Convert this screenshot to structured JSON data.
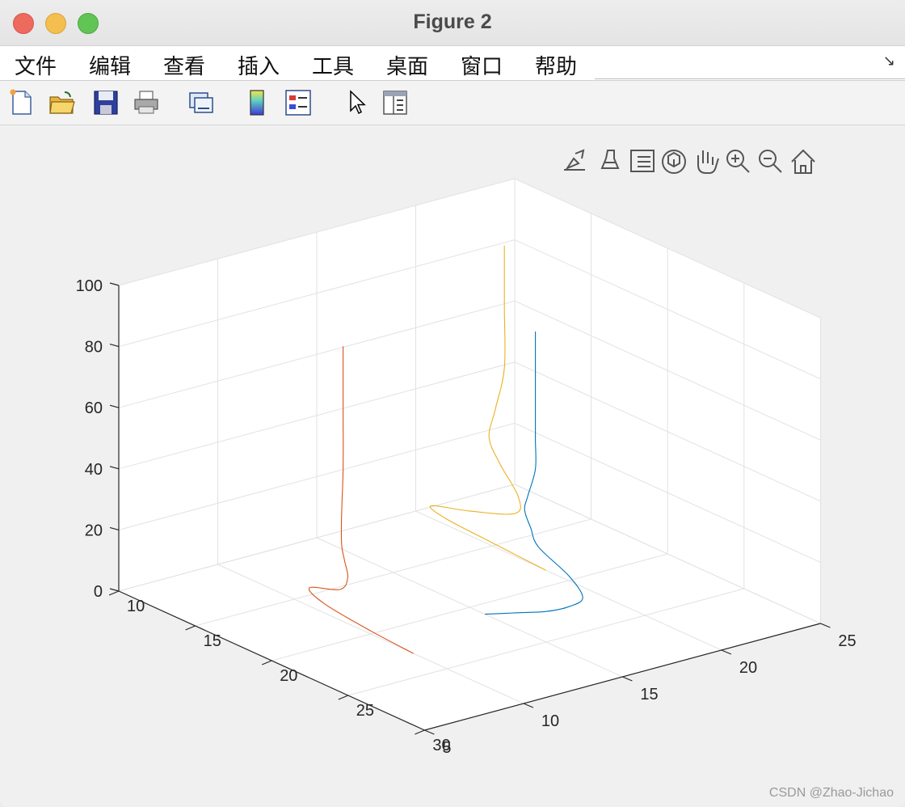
{
  "window": {
    "title": "Figure 2"
  },
  "menu": [
    "文件",
    "编辑",
    "查看",
    "插入",
    "工具",
    "桌面",
    "窗口",
    "帮助"
  ],
  "toolbar": {
    "icons": [
      "new-figure-icon",
      "open-file-icon",
      "save-icon",
      "print-icon",
      "link-plot-icon",
      "colorbar-icon",
      "legend-icon",
      "pointer-icon",
      "property-inspector-icon"
    ]
  },
  "axes_toolbar": {
    "icons": [
      "export-icon",
      "brush-icon",
      "data-tips-icon",
      "rotate-3d-icon",
      "pan-icon",
      "zoom-in-icon",
      "zoom-out-icon",
      "home-icon"
    ]
  },
  "chart_data": {
    "type": "line",
    "title": "",
    "xlabel": "",
    "ylabel": "",
    "zlabel": "",
    "xlim": [
      10,
      30
    ],
    "ylim": [
      5,
      25
    ],
    "zlim": [
      0,
      100
    ],
    "xticks": [
      "10",
      "15",
      "20",
      "25",
      "30"
    ],
    "yticks": [
      "5",
      "10",
      "15",
      "20",
      "25"
    ],
    "zticks": [
      "0",
      "20",
      "40",
      "60",
      "80",
      "100"
    ],
    "grid": true,
    "view": "3d",
    "colors": {
      "series1": "#0072bd",
      "series2": "#d95319",
      "series3": "#edb120"
    },
    "series": [
      {
        "color": "#0072bd",
        "x": [
          21.0,
          23.0,
          25.0,
          26.5,
          27.4,
          26.5,
          24.5,
          24.0,
          23.6,
          23.8,
          24.3,
          24.3,
          24.3,
          24.3
        ],
        "y": [
          15.0,
          15.0,
          15.0,
          15.0,
          15.0,
          15.0,
          15.0,
          15.0,
          15.0,
          15.0,
          15.0,
          15.0,
          15.0,
          15.0
        ],
        "z": [
          0,
          5,
          10,
          15,
          20,
          25,
          30,
          35,
          40,
          45,
          55,
          65,
          80,
          100
        ]
      },
      {
        "color": "#d95319",
        "x": [
          22.8,
          20.0,
          17.0,
          16.0,
          18.0,
          18.5,
          18.3,
          18.1,
          18.1,
          18.2,
          18.2,
          18.2
        ],
        "y": [
          10.0,
          10.0,
          10.0,
          10.0,
          10.0,
          10.0,
          10.0,
          10.0,
          10.0,
          10.0,
          10.0,
          10.0
        ],
        "z": [
          0,
          1,
          3,
          6,
          10,
          15,
          20,
          25,
          35,
          50,
          70,
          90
        ]
      },
      {
        "color": "#edb120",
        "x": [
          18.5,
          15.0,
          12.0,
          11.0,
          13.5,
          16.5,
          16.7,
          15.5,
          14.8,
          15.2,
          15.8,
          15.8,
          15.8
        ],
        "y": [
          20.0,
          20.0,
          20.0,
          20.0,
          20.0,
          20.0,
          20.0,
          20.0,
          20.0,
          20.0,
          20.0,
          20.0,
          20.0
        ],
        "z": [
          0,
          1,
          2,
          4,
          8,
          14,
          20,
          28,
          35,
          45,
          60,
          80,
          100
        ]
      }
    ]
  },
  "watermark": "CSDN @Zhao-Jichao"
}
